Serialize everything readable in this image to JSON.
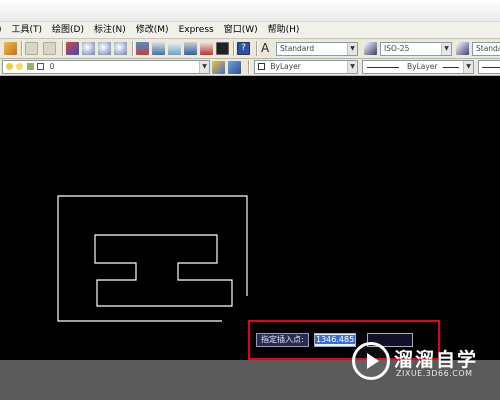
{
  "menubar": {
    "items": [
      {
        "label": ")"
      },
      {
        "label": "工具(T)"
      },
      {
        "label": "绘图(D)"
      },
      {
        "label": "标注(N)"
      },
      {
        "label": "修改(M)"
      },
      {
        "label": "Express"
      },
      {
        "label": "窗口(W)"
      },
      {
        "label": "帮助(H)"
      }
    ]
  },
  "toolbar": {
    "text_style": "Standard",
    "dim_style": "ISO-25",
    "table_style": "Standar"
  },
  "layers": {
    "current_layer": "0",
    "color": "ByLayer",
    "linetype": "ByLayer"
  },
  "dynamic_input": {
    "prompt": "指定插入点:",
    "value": "1346.485"
  },
  "watermark": {
    "title": "溜溜自学",
    "url": "ZIXUE.3D66.COM"
  },
  "colors": {
    "canvas": "#000000",
    "highlight": "#e6001e",
    "linework": "#ffffff"
  }
}
